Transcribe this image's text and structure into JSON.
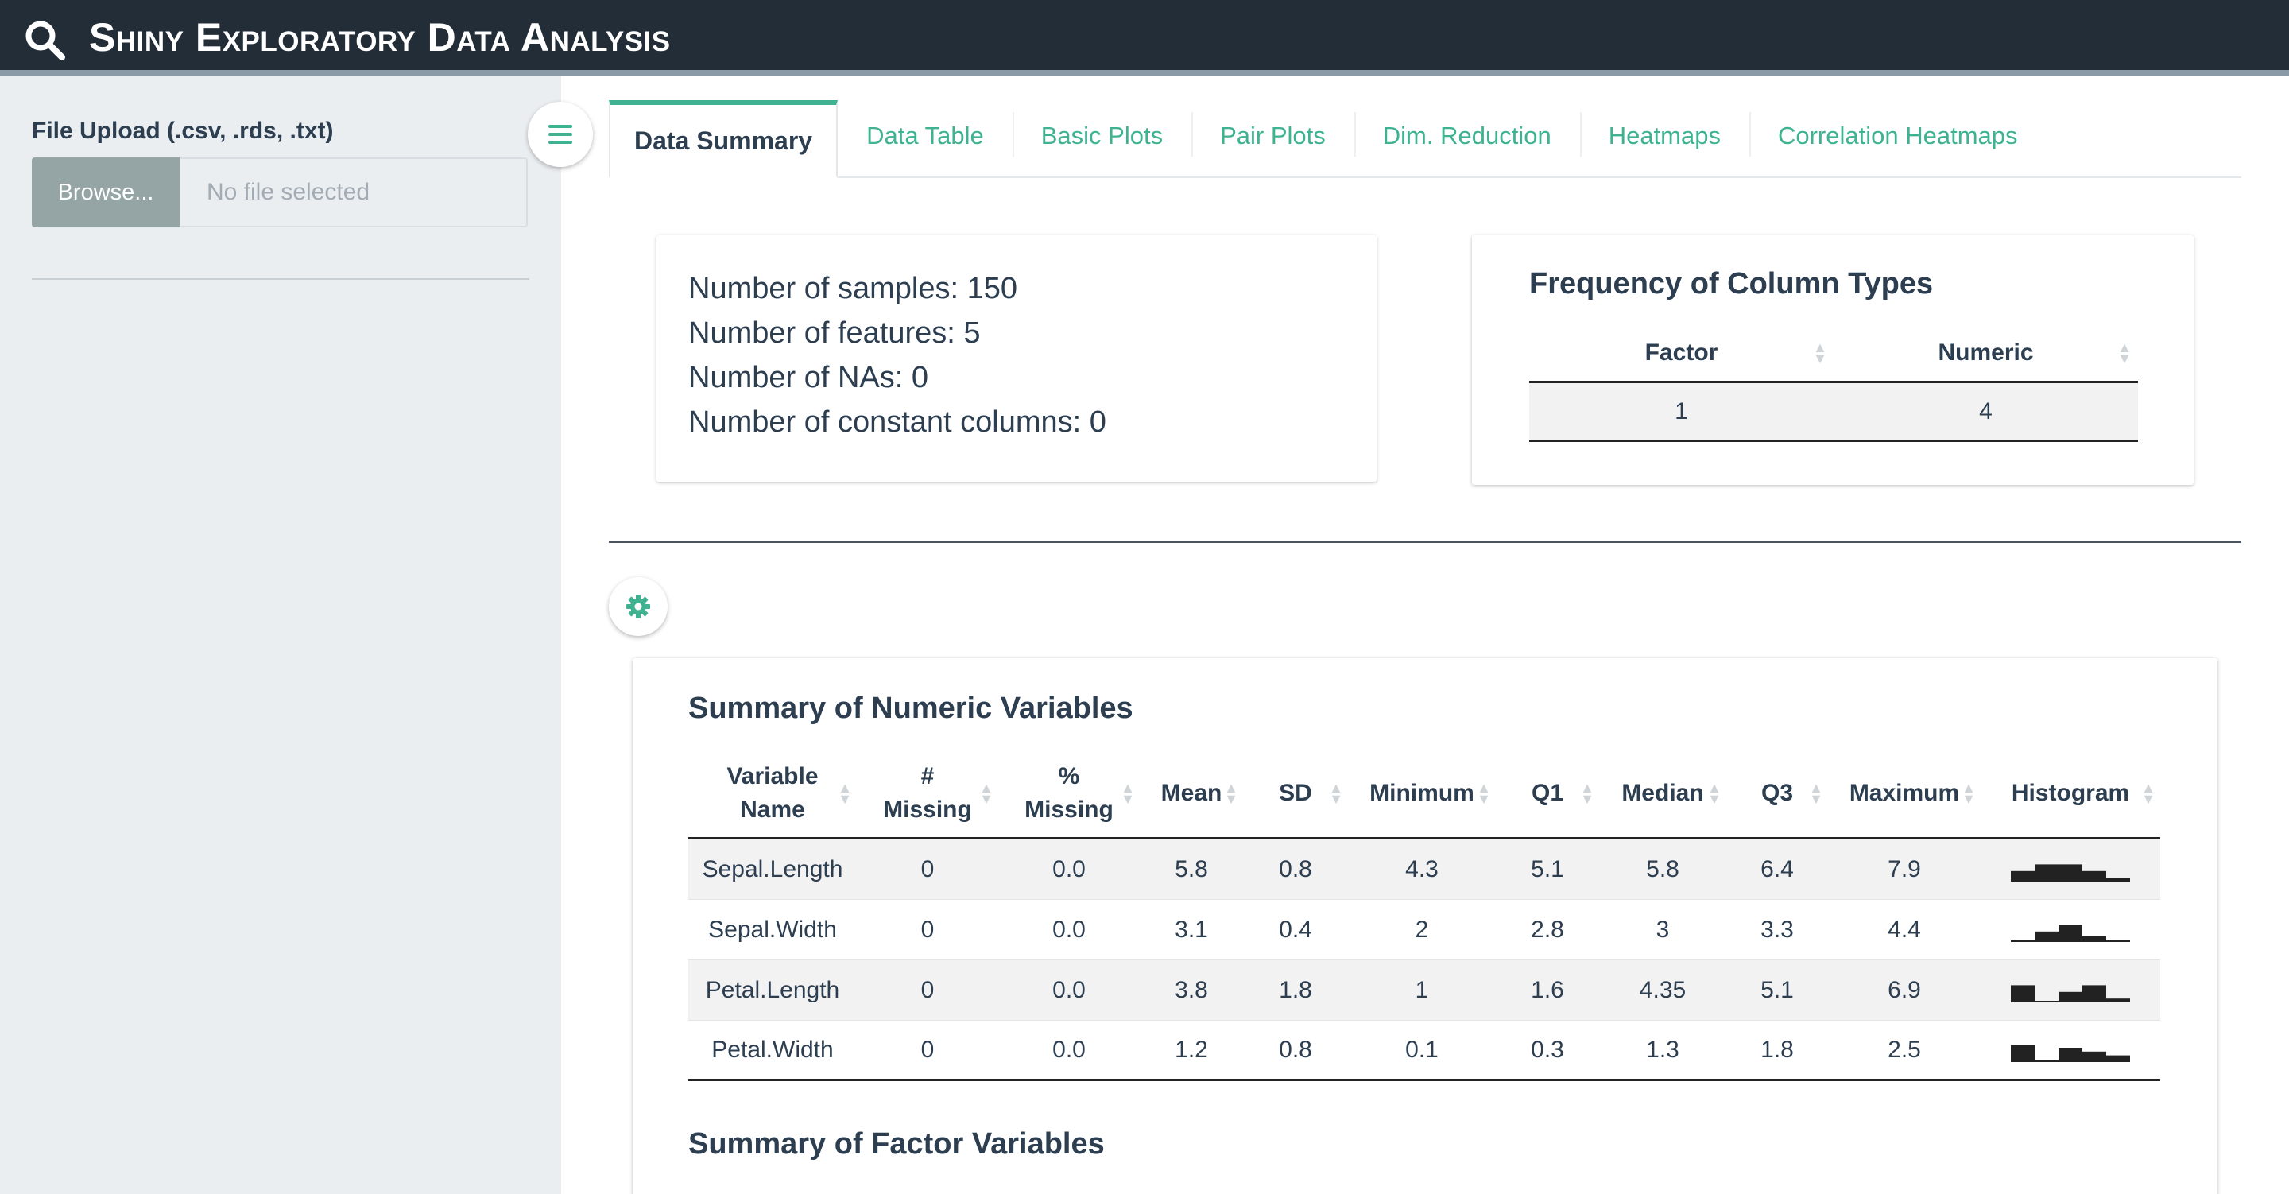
{
  "app": {
    "title": "Shiny Exploratory Data Analysis"
  },
  "colors": {
    "navbar": "#222d38",
    "accent": "#3fb391",
    "sidebar": "#ebeef1",
    "text": "#2c3e50"
  },
  "icons": {
    "brand": "search-icon",
    "sidebar_toggle": "hamburger-icon",
    "settings": "gear-icon",
    "sort": "sort-arrows-icon"
  },
  "sidebar": {
    "upload_label": "File Upload (.csv, .rds, .txt)",
    "browse_label": "Browse...",
    "file_placeholder": "No file selected"
  },
  "tabs": [
    {
      "label": "Data Summary",
      "active": true
    },
    {
      "label": "Data Table"
    },
    {
      "label": "Basic Plots"
    },
    {
      "label": "Pair Plots"
    },
    {
      "label": "Dim. Reduction"
    },
    {
      "label": "Heatmaps"
    },
    {
      "label": "Correlation Heatmaps"
    }
  ],
  "stats": [
    "Number of samples: 150",
    "Number of features: 5",
    "Number of NAs: 0",
    "Number of constant columns: 0"
  ],
  "freq": {
    "title": "Frequency of Column Types",
    "headers": [
      "Factor",
      "Numeric"
    ],
    "row": [
      "1",
      "4"
    ]
  },
  "numeric_summary": {
    "title": "Summary of Numeric Variables",
    "headers": [
      [
        "Variable",
        "Name"
      ],
      [
        "#",
        "Missing"
      ],
      [
        "%",
        "Missing"
      ],
      [
        "Mean"
      ],
      [
        "SD"
      ],
      [
        "Minimum"
      ],
      [
        "Q1"
      ],
      [
        "Median"
      ],
      [
        "Q3"
      ],
      [
        "Maximum"
      ],
      [
        "Histogram"
      ]
    ],
    "rows": [
      {
        "cells": [
          "Sepal.Length",
          "0",
          "0.0",
          "5.8",
          "0.8",
          "4.3",
          "5.1",
          "5.8",
          "6.4",
          "7.9"
        ],
        "hist": [
          0.55,
          0.9,
          0.9,
          0.55,
          0.2
        ]
      },
      {
        "cells": [
          "Sepal.Width",
          "0",
          "0.0",
          "3.1",
          "0.4",
          "2",
          "2.8",
          "3",
          "3.3",
          "4.4"
        ],
        "hist": [
          0.05,
          0.55,
          0.9,
          0.3,
          0.05
        ]
      },
      {
        "cells": [
          "Petal.Length",
          "0",
          "0.0",
          "3.8",
          "1.8",
          "1",
          "1.6",
          "4.35",
          "5.1",
          "6.9"
        ],
        "hist": [
          0.9,
          0.05,
          0.55,
          0.9,
          0.2
        ]
      },
      {
        "cells": [
          "Petal.Width",
          "0",
          "0.0",
          "1.2",
          "0.8",
          "0.1",
          "0.3",
          "1.3",
          "1.8",
          "2.5"
        ],
        "hist": [
          0.9,
          0.1,
          0.75,
          0.55,
          0.35
        ]
      }
    ]
  },
  "factor_summary": {
    "title": "Summary of Factor Variables"
  }
}
